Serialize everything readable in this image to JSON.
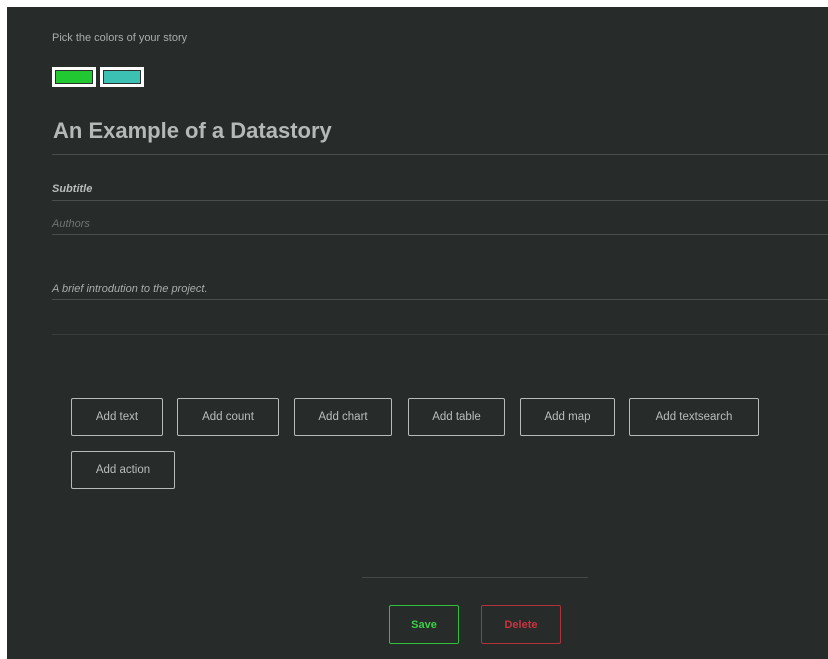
{
  "colors": {
    "label": "Pick the colors of your story",
    "primary": "#22c832",
    "secondary": "#3dc0b4",
    "background": "#272b2a",
    "save": "#3ccf47",
    "delete": "#c8343e"
  },
  "story": {
    "title": "An Example of a Datastory",
    "subtitle_placeholder": "Subtitle",
    "authors_placeholder": "Authors",
    "intro_placeholder": "A brief introdution to the project."
  },
  "add_buttons": [
    "Add text",
    "Add count",
    "Add chart",
    "Add table",
    "Add map",
    "Add textsearch",
    "Add action"
  ],
  "footer": {
    "save_label": "Save",
    "delete_label": "Delete"
  }
}
